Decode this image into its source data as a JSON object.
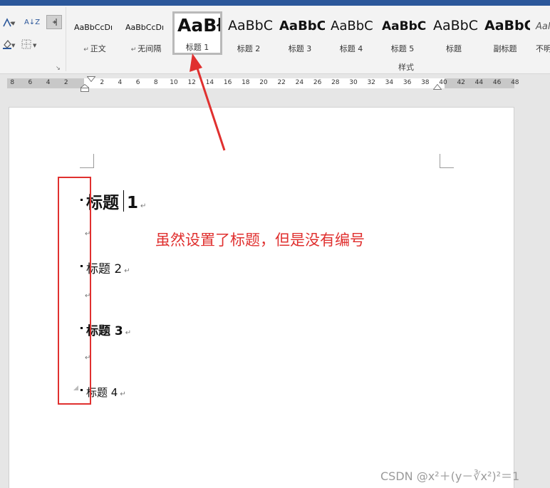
{
  "ribbon": {
    "styles": [
      {
        "preview": "AaBbCcDı",
        "name": "正文",
        "paragraph_mark": "↵",
        "selected": false
      },
      {
        "preview": "AaBbCcDı",
        "name": "无间隔",
        "paragraph_mark": "↵",
        "selected": false
      },
      {
        "preview": "AaBł",
        "name": "标题 1",
        "paragraph_mark": "",
        "selected": true
      },
      {
        "preview": "AaBbC",
        "name": "标题 2",
        "paragraph_mark": "",
        "selected": false
      },
      {
        "preview": "AaBbC",
        "name": "标题 3",
        "paragraph_mark": "",
        "selected": false
      },
      {
        "preview": "AaBbC",
        "name": "标题 4",
        "paragraph_mark": "",
        "selected": false
      },
      {
        "preview": "AaBbC",
        "name": "标题 5",
        "paragraph_mark": "",
        "selected": false
      },
      {
        "preview": "AaBbC",
        "name": "标题",
        "paragraph_mark": "",
        "selected": false
      },
      {
        "preview": "AaBbC",
        "name": "副标题",
        "paragraph_mark": "",
        "selected": false
      },
      {
        "preview": "Aal",
        "name": "不明",
        "paragraph_mark": "",
        "selected": false
      }
    ],
    "group_label": "样式",
    "sort_icon_text": "A↓Z",
    "launcher_glyph": "↘"
  },
  "ruler": {
    "left_numbers": [
      "8",
      "6",
      "4",
      "2"
    ],
    "right_numbers": [
      "2",
      "4",
      "6",
      "8",
      "10",
      "12",
      "14",
      "16",
      "18",
      "20",
      "22",
      "24",
      "26",
      "28",
      "30",
      "32",
      "34",
      "36",
      "38",
      "40",
      "42",
      "44",
      "46",
      "48"
    ]
  },
  "document": {
    "headings": [
      {
        "text": "标题",
        "suffix": "1",
        "level": 1
      },
      {
        "text": "标题 2",
        "level": 2
      },
      {
        "text": "标题 3",
        "level": 3
      },
      {
        "text": "标题 4",
        "level": 4
      }
    ],
    "paragraph_mark": "↵"
  },
  "annotation": {
    "text": "虽然设置了标题，但是没有编号",
    "color": "#e0302f"
  },
  "watermark": "CSDN @x²＋(y－∛x²)²＝1"
}
